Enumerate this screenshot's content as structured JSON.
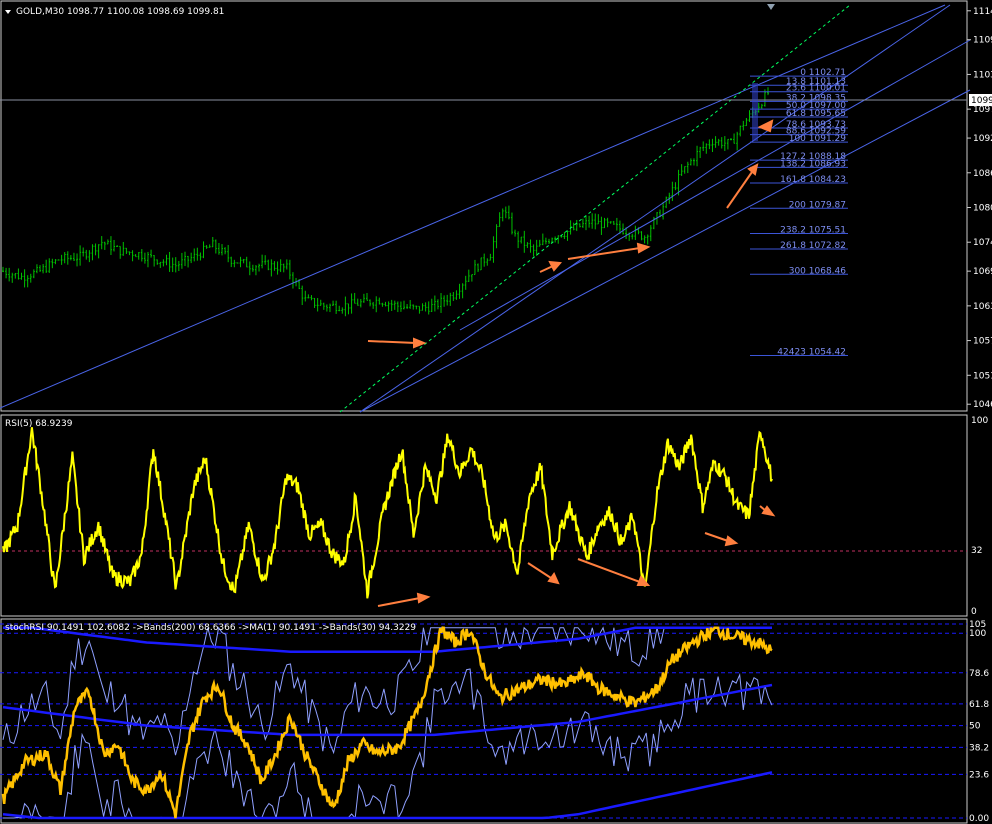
{
  "header": {
    "main_title": "GOLD,M30  1098.77 1100.08 1098.69 1099.81",
    "rsi_title": "RSI(5) 68.9239",
    "stoch_title": "stochRSI 90.1491 102.6082  ->Bands(200) 68.6366  ->MA(1) 90.1491  ->Bands(30) 94.3229"
  },
  "colors": {
    "background": "#000000",
    "candles": "#00c000",
    "channel_lines": "#4a64e8",
    "fib_lines": "#3c55d8",
    "fib_text": "#7d8df0",
    "rsi_line": "#ffff00",
    "stoch_line": "#ffc000",
    "bands_200": "#1a1aff",
    "bands_30": "#8fa0ff",
    "arrows": "#ff7f3f",
    "rsi_level": "#c03060",
    "price_marker": "#ffffff"
  },
  "chart_data": [
    {
      "type": "candlestick",
      "title": "GOLD,M30",
      "ylim": [
        1045,
        1115
      ],
      "y_ticks": [
        "1114",
        "1109",
        "1103",
        "1097",
        "1092",
        "1086",
        "1080",
        "1074",
        "1069",
        "1063",
        "1057",
        "1051",
        "1046"
      ],
      "current_price": "1099",
      "close_anchors": [
        [
          0,
          1069
        ],
        [
          6,
          1068
        ],
        [
          12,
          1069
        ],
        [
          18,
          1071
        ],
        [
          25,
          1071.5
        ],
        [
          32,
          1074
        ],
        [
          38,
          1072.5
        ],
        [
          44,
          1072
        ],
        [
          50,
          1071
        ],
        [
          56,
          1070
        ],
        [
          62,
          1071.5
        ],
        [
          68,
          1073.5
        ],
        [
          74,
          1071
        ],
        [
          80,
          1070
        ],
        [
          86,
          1070
        ],
        [
          92,
          1069.5
        ],
        [
          98,
          1064
        ],
        [
          104,
          1063
        ],
        [
          110,
          1063
        ],
        [
          116,
          1063.5
        ],
        [
          122,
          1064
        ],
        [
          128,
          1063
        ],
        [
          134,
          1062.5
        ],
        [
          140,
          1063
        ],
        [
          146,
          1065
        ],
        [
          152,
          1069
        ],
        [
          158,
          1072
        ],
        [
          162,
          1080
        ],
        [
          166,
          1075
        ],
        [
          172,
          1072.5
        ],
        [
          178,
          1075
        ],
        [
          184,
          1076
        ],
        [
          190,
          1077.5
        ],
        [
          196,
          1077
        ],
        [
          202,
          1076
        ],
        [
          208,
          1075
        ],
        [
          214,
          1080
        ],
        [
          220,
          1086
        ],
        [
          226,
          1090
        ],
        [
          230,
          1091.5
        ],
        [
          236,
          1091
        ],
        [
          240,
          1094.5
        ],
        [
          244,
          1097
        ],
        [
          248,
          1099.81
        ]
      ],
      "fibonacci_levels": [
        {
          "level": "0",
          "price": "1102.71"
        },
        {
          "level": "13.8",
          "price": "1101.13"
        },
        {
          "level": "23.6",
          "price": "1100.01"
        },
        {
          "level": "38.2",
          "price": "1098.35"
        },
        {
          "level": "50.0",
          "price": "1097.00"
        },
        {
          "level": "61.8",
          "price": "1095.65"
        },
        {
          "level": "78.6",
          "price": "1093.73"
        },
        {
          "level": "88.6",
          "price": "1092.59"
        },
        {
          "level": "100",
          "price": "1091.29"
        },
        {
          "level": "127.2",
          "price": "1088.18"
        },
        {
          "level": "138.2",
          "price": "1086.93"
        },
        {
          "level": "161.8",
          "price": "1084.23"
        },
        {
          "level": "200",
          "price": "1079.87"
        },
        {
          "level": "238.2",
          "price": "1075.51"
        },
        {
          "level": "261.8",
          "price": "1072.82"
        },
        {
          "level": "300",
          "price": "1068.46"
        },
        {
          "level": "42423",
          "price": "1054.42"
        }
      ]
    },
    {
      "type": "line",
      "title": "RSI(5) 68.9239",
      "ylim": [
        0,
        100
      ],
      "y_ticks": [
        "100",
        "32",
        "0"
      ],
      "level": 32,
      "series": [
        {
          "name": "RSI(5)",
          "anchors": [
            [
              0,
              30
            ],
            [
              5,
              45
            ],
            [
              10,
              95
            ],
            [
              14,
              55
            ],
            [
              18,
              10
            ],
            [
              24,
              80
            ],
            [
              28,
              28
            ],
            [
              33,
              45
            ],
            [
              38,
              18
            ],
            [
              44,
              15
            ],
            [
              48,
              30
            ],
            [
              52,
              85
            ],
            [
              56,
              50
            ],
            [
              60,
              12
            ],
            [
              66,
              65
            ],
            [
              70,
              80
            ],
            [
              76,
              25
            ],
            [
              80,
              10
            ],
            [
              85,
              45
            ],
            [
              90,
              15
            ],
            [
              94,
              35
            ],
            [
              98,
              70
            ],
            [
              102,
              65
            ],
            [
              106,
              40
            ],
            [
              110,
              45
            ],
            [
              114,
              30
            ],
            [
              118,
              25
            ],
            [
              122,
              60
            ],
            [
              126,
              10
            ],
            [
              132,
              55
            ],
            [
              138,
              85
            ],
            [
              142,
              40
            ],
            [
              146,
              75
            ],
            [
              150,
              60
            ],
            [
              154,
              92
            ],
            [
              158,
              72
            ],
            [
              162,
              85
            ],
            [
              166,
              70
            ],
            [
              170,
              38
            ],
            [
              174,
              45
            ],
            [
              178,
              20
            ],
            [
              182,
              60
            ],
            [
              186,
              75
            ],
            [
              190,
              30
            ],
            [
              196,
              55
            ],
            [
              202,
              28
            ],
            [
              206,
              45
            ],
            [
              210,
              52
            ],
            [
              214,
              35
            ],
            [
              218,
              50
            ],
            [
              222,
              10
            ],
            [
              226,
              60
            ],
            [
              230,
              88
            ],
            [
              234,
              75
            ],
            [
              238,
              92
            ],
            [
              242,
              55
            ],
            [
              246,
              78
            ],
            [
              250,
              70
            ],
            [
              254,
              55
            ],
            [
              258,
              50
            ],
            [
              262,
              95
            ],
            [
              266,
              68.9
            ]
          ]
        }
      ]
    },
    {
      "type": "line",
      "title": "stochRSI",
      "ylim": [
        0,
        105
      ],
      "y_ticks": [
        "105",
        "100",
        "78.6",
        "61.8",
        "50",
        "38.2",
        "23.6",
        "0.00"
      ],
      "series": [
        {
          "name": "stochRSI",
          "anchors": [
            [
              0,
              10
            ],
            [
              6,
              30
            ],
            [
              12,
              35
            ],
            [
              16,
              15
            ],
            [
              20,
              60
            ],
            [
              24,
              68
            ],
            [
              28,
              35
            ],
            [
              32,
              40
            ],
            [
              36,
              20
            ],
            [
              40,
              15
            ],
            [
              44,
              25
            ],
            [
              48,
              2
            ],
            [
              52,
              45
            ],
            [
              56,
              65
            ],
            [
              60,
              72
            ],
            [
              64,
              50
            ],
            [
              68,
              40
            ],
            [
              72,
              20
            ],
            [
              76,
              35
            ],
            [
              80,
              55
            ],
            [
              84,
              35
            ],
            [
              88,
              20
            ],
            [
              92,
              5
            ],
            [
              96,
              30
            ],
            [
              100,
              40
            ],
            [
              104,
              35
            ],
            [
              110,
              38
            ],
            [
              116,
              60
            ],
            [
              122,
              102
            ],
            [
              126,
              95
            ],
            [
              130,
              102
            ],
            [
              134,
              80
            ],
            [
              138,
              65
            ],
            [
              144,
              70
            ],
            [
              150,
              75
            ],
            [
              156,
              72
            ],
            [
              162,
              78
            ],
            [
              166,
              70
            ],
            [
              172,
              65
            ],
            [
              176,
              62
            ],
            [
              182,
              70
            ],
            [
              186,
              85
            ],
            [
              192,
              95
            ],
            [
              198,
              102
            ],
            [
              204,
              98
            ],
            [
              210,
              95
            ],
            [
              214,
              90.1
            ]
          ]
        },
        {
          "name": "Bands(200)",
          "anchors": [
            [
              0,
              60
            ],
            [
              40,
              50
            ],
            [
              80,
              45
            ],
            [
              120,
              45
            ],
            [
              160,
              52
            ],
            [
              214,
              72
            ]
          ]
        },
        {
          "name": "Bands(30)",
          "anchors": [
            [
              0,
              55
            ],
            [
              30,
              50
            ],
            [
              60,
              48
            ],
            [
              90,
              45
            ],
            [
              120,
              48
            ],
            [
              150,
              70
            ],
            [
              180,
              85
            ],
            [
              214,
              94.3
            ]
          ]
        }
      ]
    }
  ]
}
